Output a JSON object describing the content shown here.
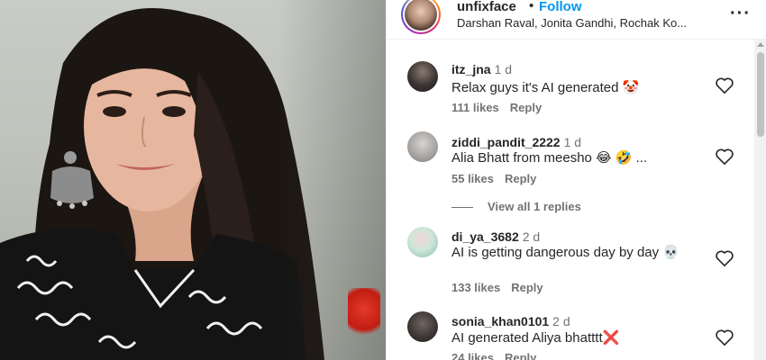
{
  "header": {
    "username": "unfixface",
    "separator": "•",
    "follow_label": "Follow",
    "subtitle": "Darshan Raval, Jonita Gandhi, Rochak Ko...",
    "more_label": "···"
  },
  "comments": [
    {
      "username": "itz_jna",
      "time": "1 d",
      "text": "Relax guys it's AI generated 🤡",
      "likes": "111 likes",
      "reply_label": "Reply"
    },
    {
      "username": "ziddi_pandit_2222",
      "time": "1 d",
      "text": "Alia Bhatt from meesho 😂 🤣 ...",
      "likes": "55 likes",
      "reply_label": "Reply",
      "view_replies": "View all 1 replies"
    },
    {
      "username": "di_ya_3682",
      "time": "2 d",
      "text": "AI is getting dangerous day by day 💀",
      "likes": "133 likes",
      "reply_label": "Reply"
    },
    {
      "username": "sonia_khan0101",
      "time": "2 d",
      "text": "AI generated Aliya bhatttt❌",
      "likes": "24 likes",
      "reply_label": "Reply"
    }
  ],
  "icons": {
    "like": "heart-icon",
    "more": "more-options-icon"
  },
  "colors": {
    "follow_blue": "#0095f6",
    "text_primary": "#262626",
    "text_secondary": "#737373"
  }
}
